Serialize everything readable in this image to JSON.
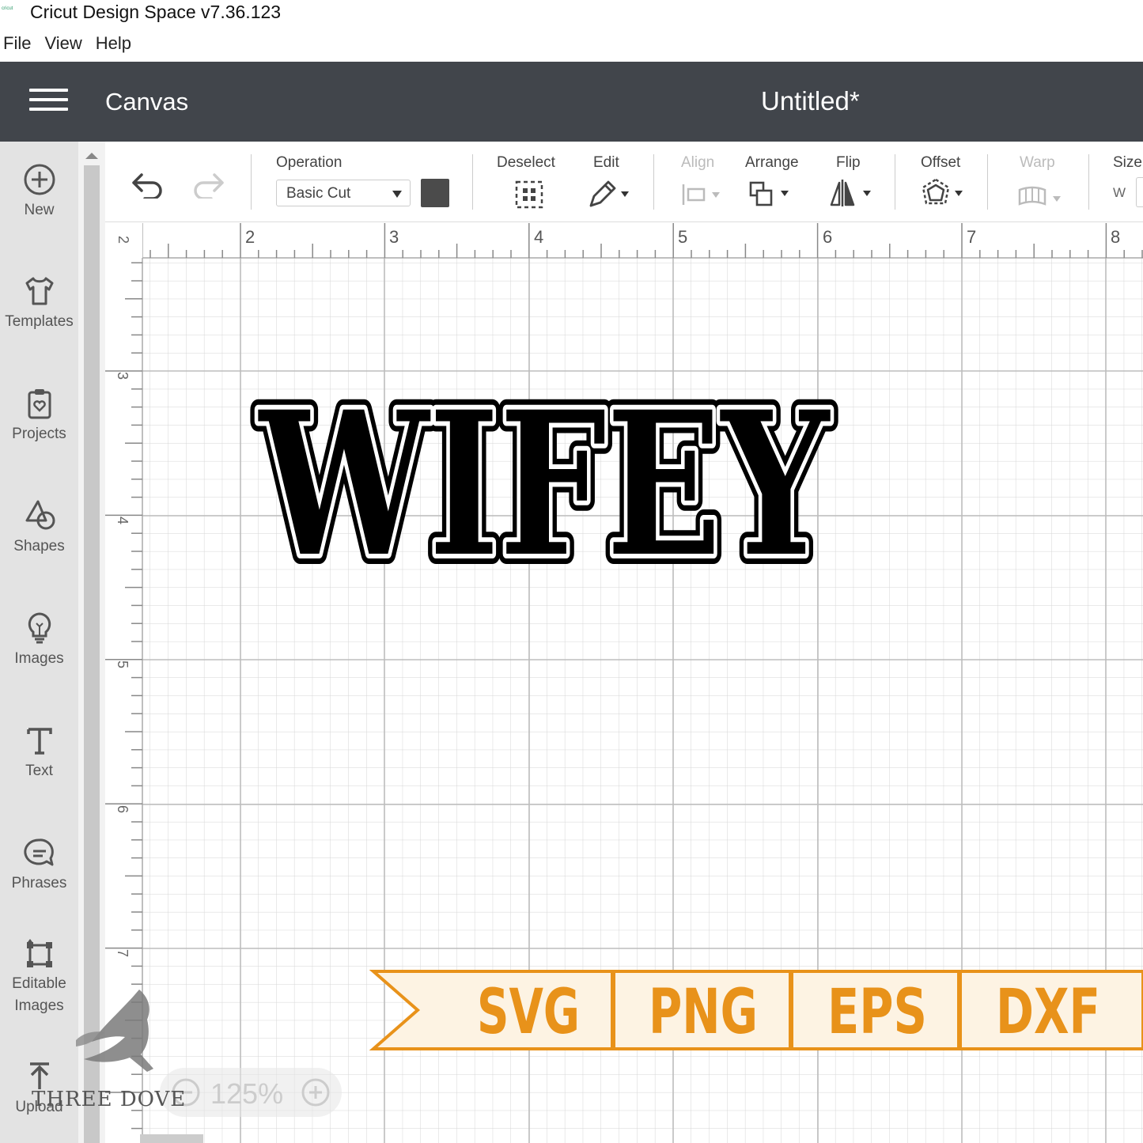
{
  "window": {
    "title": "Cricut Design Space  v7.36.123"
  },
  "menu": [
    "File",
    "View",
    "Help"
  ],
  "header": {
    "section": "Canvas",
    "document": "Untitled*"
  },
  "sidebar": {
    "items": [
      {
        "label": "New",
        "icon": "plus-circle-icon"
      },
      {
        "label": "Templates",
        "icon": "shirt-icon"
      },
      {
        "label": "Projects",
        "icon": "clipboard-icon"
      },
      {
        "label": "Shapes",
        "icon": "shapes-icon"
      },
      {
        "label": "Images",
        "icon": "lightbulb-icon"
      },
      {
        "label": "Text",
        "icon": "text-icon"
      },
      {
        "label": "Phrases",
        "icon": "speech-bubble-icon"
      },
      {
        "label": "Editable",
        "label2": "Images",
        "icon": "editable-images-icon"
      },
      {
        "label": "Upload",
        "icon": "upload-icon"
      }
    ]
  },
  "toolbar": {
    "operation_label": "Operation",
    "operation_value": "Basic Cut",
    "operation_color": "#4b4b4b",
    "deselect": "Deselect",
    "edit": "Edit",
    "align": "Align",
    "arrange": "Arrange",
    "flip": "Flip",
    "offset": "Offset",
    "warp": "Warp",
    "size": "Size",
    "size_w": "W"
  },
  "rulers": {
    "horizontal": [
      "2",
      "2",
      "3",
      "4",
      "5",
      "6",
      "7",
      "8"
    ],
    "vertical": [
      "3",
      "4",
      "5",
      "6",
      "7"
    ]
  },
  "design": {
    "text": "WIFEY"
  },
  "banner": {
    "formats": [
      "SVG",
      "PNG",
      "EPS",
      "DXF"
    ],
    "color": "#e8921a",
    "background": "#fdf3e3"
  },
  "watermark": {
    "text": "THREE DOVE"
  },
  "zoom": {
    "value": "125%"
  }
}
